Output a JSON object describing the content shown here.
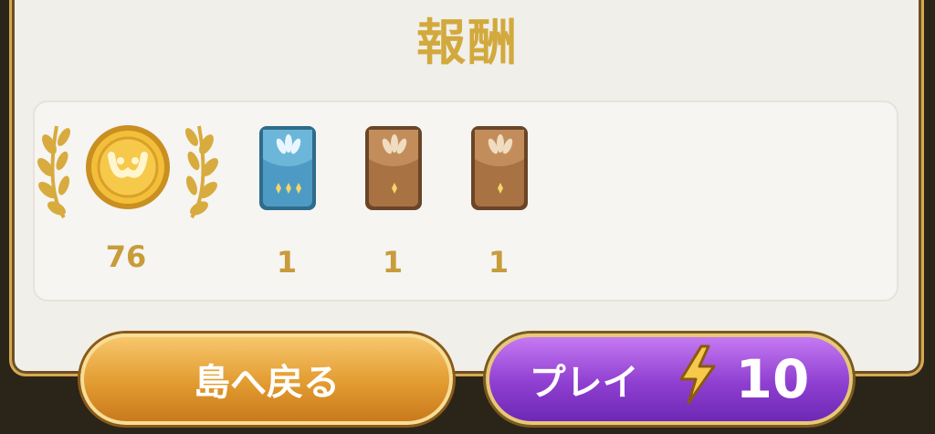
{
  "title": "報酬",
  "rewards": [
    {
      "icon": "gold-coin-icon",
      "count": "76"
    },
    {
      "icon": "blue-pack-icon",
      "count": "1"
    },
    {
      "icon": "brown-pack-icon",
      "count": "1"
    },
    {
      "icon": "brown-pack-icon",
      "count": "1"
    }
  ],
  "buttons": {
    "back_label": "島へ戻る",
    "play_label": "プレイ",
    "play_cost": "10"
  },
  "colors": {
    "gold_text": "#d2a93c",
    "back_button": "#e29b30",
    "play_button": "#8f3fd0"
  }
}
